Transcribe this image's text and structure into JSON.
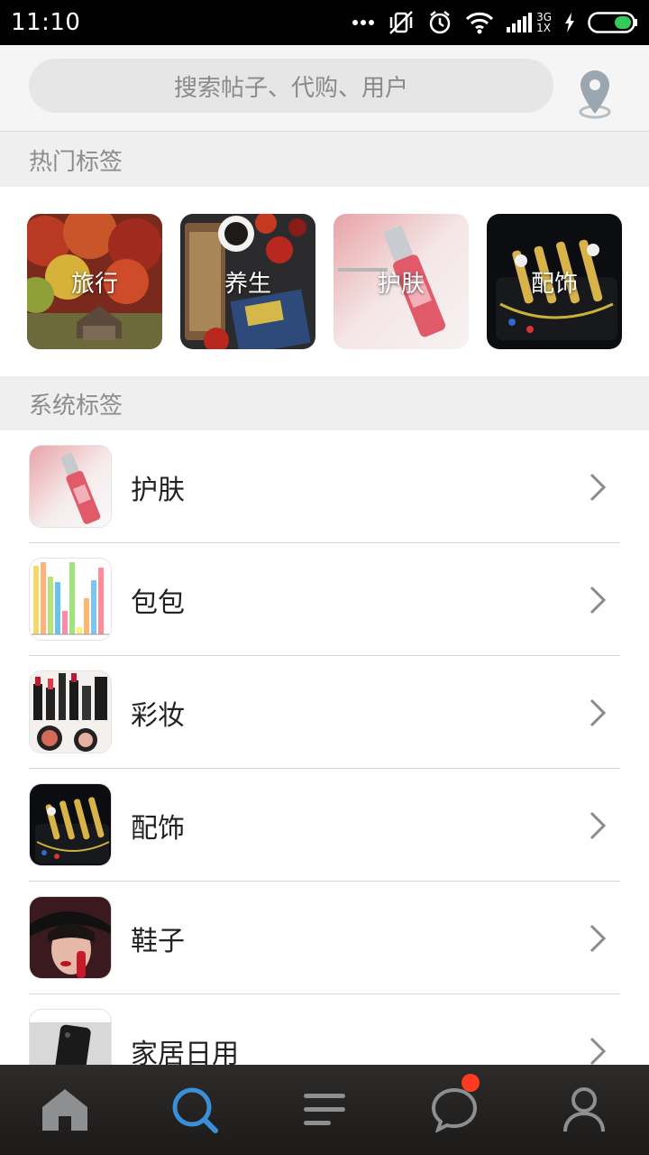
{
  "status_bar": {
    "time": "11:10",
    "network": [
      "3G",
      "1X"
    ],
    "icons": [
      "more-dots-icon",
      "vibrate-off-icon",
      "alarm-icon",
      "wifi-icon",
      "signal-icon",
      "charging-icon",
      "battery-icon"
    ]
  },
  "search": {
    "placeholder": "搜索帖子、代购、用户",
    "location_icon": "location-pin-icon"
  },
  "hot_tags": {
    "title": "热门标签",
    "items": [
      {
        "label": "旅行",
        "image": "autumn-landscape"
      },
      {
        "label": "养生",
        "image": "breakfast-table"
      },
      {
        "label": "护肤",
        "image": "serum-bottle"
      },
      {
        "label": "配饰",
        "image": "watches"
      }
    ]
  },
  "system_tags": {
    "title": "系统标签",
    "items": [
      {
        "label": "护肤",
        "image": "serum-bottle"
      },
      {
        "label": "包包",
        "image": "bar-chart"
      },
      {
        "label": "彩妆",
        "image": "lipsticks"
      },
      {
        "label": "配饰",
        "image": "watches"
      },
      {
        "label": "鞋子",
        "image": "woman-hat"
      },
      {
        "label": "家居日用",
        "image": "phone-case"
      }
    ]
  },
  "bottom_nav": {
    "items": [
      {
        "name": "home",
        "icon": "home-icon",
        "active": false
      },
      {
        "name": "search",
        "icon": "search-icon",
        "active": true
      },
      {
        "name": "feed",
        "icon": "menu-lines-icon",
        "active": false
      },
      {
        "name": "messages",
        "icon": "chat-bubble-icon",
        "active": false,
        "badge": true
      },
      {
        "name": "profile",
        "icon": "user-icon",
        "active": false
      }
    ]
  },
  "colors": {
    "accent": "#3a8fd8",
    "badge": "#ff3b1f",
    "nav_bg": "#232120"
  }
}
